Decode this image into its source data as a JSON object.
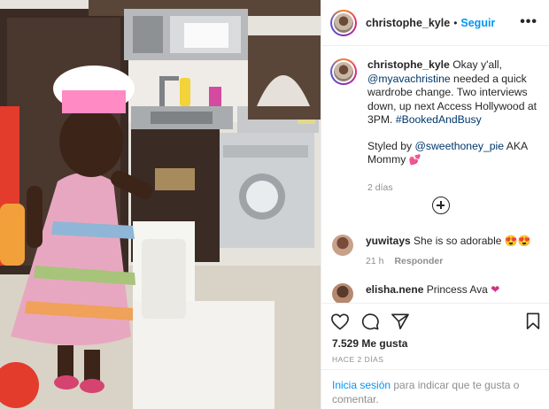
{
  "post": {
    "username": "christophe_kyle",
    "follow_label": "Seguir",
    "more_label": "•••",
    "caption": {
      "username": "christophe_kyle",
      "text_1": " Okay y'all, ",
      "mention_1": "@myavachristine",
      "text_2": " needed a quick wardrobe change. Two interviews down, up next Access Hollywood at 3PM. ",
      "hashtag": "#BookedAndBusy",
      "styled_prefix": "Styled by ",
      "mention_2": "@sweethoney_pie",
      "styled_suffix": " AKA Mommy ",
      "styled_emoji": "💕",
      "time": "2 días"
    },
    "comments": [
      {
        "username": "yuwitays",
        "text": " She is so adorable ",
        "emoji": "😍😍",
        "time": "21 h",
        "reply_label": "Responder"
      },
      {
        "username": "elisha.nene",
        "text": " Princess Ava ",
        "emoji": "❤"
      }
    ],
    "likes": "7.529 Me gusta",
    "posted_ago": "HACE 2 DÍAS",
    "login": {
      "link": "Inicia sesión",
      "text": " para indicar que te gusta o comentar."
    }
  },
  "colors": {
    "link_blue": "#0095f6",
    "mention_blue": "#00376b",
    "secondary_text": "#8e8e8e",
    "border": "#efefef"
  }
}
